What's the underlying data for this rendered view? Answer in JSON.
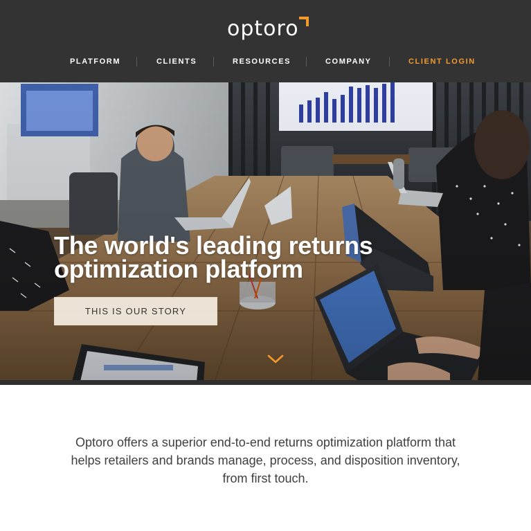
{
  "header": {
    "logo_text": "optoro",
    "nav": [
      {
        "label": "PLATFORM"
      },
      {
        "label": "CLIENTS"
      },
      {
        "label": "RESOURCES"
      },
      {
        "label": "COMPANY"
      },
      {
        "label": "CLIENT LOGIN"
      }
    ]
  },
  "hero": {
    "title_line1": "The world's leading returns",
    "title_line2": "optimization platform",
    "cta_label": "THIS IS OUR STORY"
  },
  "intro": {
    "text": "Optoro offers a superior end-to-end returns optimization platform that helps retailers and brands manage, process, and disposition inventory, from first touch."
  },
  "colors": {
    "header_bg": "#333333",
    "accent": "#f29a2e",
    "text": "#3f3f3f"
  },
  "icons": [
    "logo-mark-icon",
    "chevron-down-icon"
  ]
}
